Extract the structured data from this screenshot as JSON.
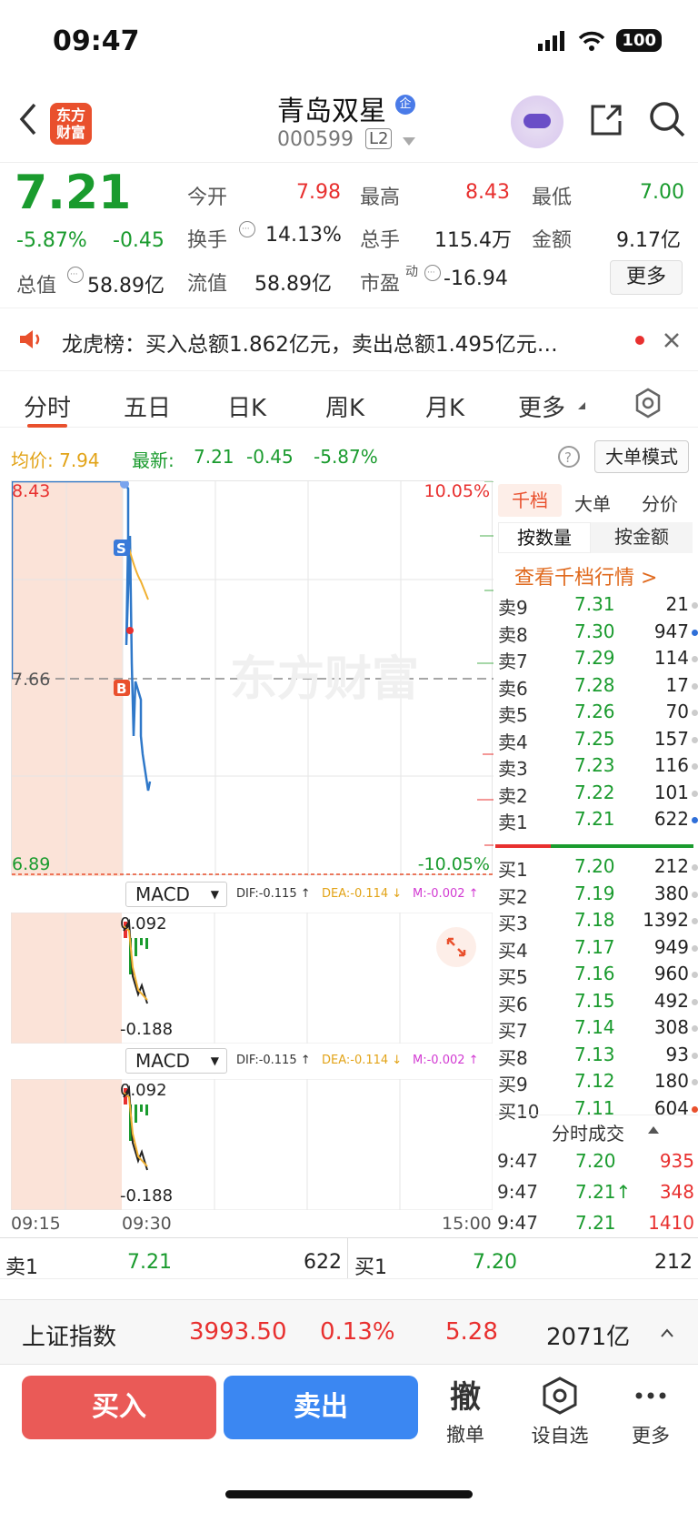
{
  "status": {
    "time": "09:47",
    "battery": "100"
  },
  "header": {
    "logo": "东方\n财富",
    "name": "青岛双星",
    "badge": "企",
    "code": "000599",
    "level": "L2"
  },
  "quote": {
    "price": "7.21",
    "pct": "-5.87%",
    "chg": "-0.45",
    "open_l": "今开",
    "open": "7.98",
    "high_l": "最高",
    "high": "8.43",
    "low_l": "最低",
    "low": "7.00",
    "turn_l": "换手",
    "turn": "14.13%",
    "vol_l": "总手",
    "vol": "115.4万",
    "amt_l": "金额",
    "amt": "9.17亿",
    "mcap_l": "总值",
    "mcap": "58.89亿",
    "float_l": "流值",
    "float": "58.89亿",
    "pe_l": "市盈",
    "pe_sup": "动",
    "pe": "-16.94",
    "more": "更多"
  },
  "notice": {
    "text": "龙虎榜：买入总额1.862亿元，卖出总额1.495亿元…"
  },
  "tabs": [
    "分时",
    "五日",
    "日K",
    "周K",
    "月K",
    "更多"
  ],
  "info": {
    "avg": "均价: 7.94",
    "latest_l": "最新:",
    "latest": "7.21",
    "chg": "-0.45",
    "pct": "-5.87%",
    "mode": "大单模式"
  },
  "chart": {
    "top": "8.43",
    "mid": "7.66",
    "bot": "6.89",
    "top_pct": "10.05%",
    "bot_pct": "-10.05%",
    "t0": "09:15",
    "t1": "09:30",
    "t2": "15:00",
    "watermark": "东方财富"
  },
  "macd": {
    "label": "MACD",
    "dif": "DIF:-0.115 ↑",
    "dea": "DEA:-0.114 ↓",
    "m": "M:-0.002 ↑",
    "hi": "0.092",
    "lo": "-0.188"
  },
  "book": {
    "tabs": [
      "千档",
      "大单",
      "分价"
    ],
    "sub": [
      "按数量",
      "按金额"
    ],
    "link": "查看千档行情 >",
    "asks": [
      [
        "卖9",
        "7.31",
        "21"
      ],
      [
        "卖8",
        "7.30",
        "947"
      ],
      [
        "卖7",
        "7.29",
        "114"
      ],
      [
        "卖6",
        "7.28",
        "17"
      ],
      [
        "卖5",
        "7.26",
        "70"
      ],
      [
        "卖4",
        "7.25",
        "157"
      ],
      [
        "卖3",
        "7.23",
        "116"
      ],
      [
        "卖2",
        "7.22",
        "101"
      ],
      [
        "卖1",
        "7.21",
        "622"
      ]
    ],
    "bids": [
      [
        "买1",
        "7.20",
        "212"
      ],
      [
        "买2",
        "7.19",
        "380"
      ],
      [
        "买3",
        "7.18",
        "1392"
      ],
      [
        "买4",
        "7.17",
        "949"
      ],
      [
        "买5",
        "7.16",
        "960"
      ],
      [
        "买6",
        "7.15",
        "492"
      ],
      [
        "买7",
        "7.14",
        "308"
      ],
      [
        "买8",
        "7.13",
        "93"
      ],
      [
        "买9",
        "7.12",
        "180"
      ],
      [
        "买10",
        "7.11",
        "604"
      ]
    ],
    "trades_title": "分时成交",
    "trades": [
      [
        "9:47",
        "7.20",
        "935"
      ],
      [
        "9:47",
        "7.21↑",
        "348"
      ],
      [
        "9:47",
        "7.21",
        "1410"
      ]
    ]
  },
  "bottom": {
    "s1l": "卖1",
    "s1p": "7.21",
    "s1v": "622",
    "b1l": "买1",
    "b1p": "7.20",
    "b1v": "212"
  },
  "index": {
    "name": "上证指数",
    "val": "3993.50",
    "pct": "0.13%",
    "chg": "5.28",
    "amt": "2071亿"
  },
  "actions": {
    "buy": "买入",
    "sell": "卖出",
    "cancel_icon": "撤",
    "cancel": "撤单",
    "fav": "设自选",
    "more": "更多"
  }
}
